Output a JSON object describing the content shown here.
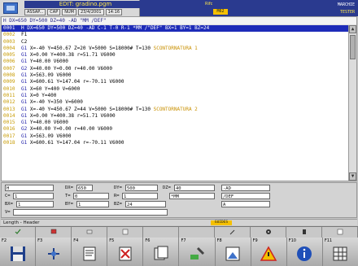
{
  "titlebar": {
    "title": "EDIT: gradino.pgm",
    "fields": [
      "ASSAP...",
      "CAP",
      "NUM",
      "23/4/2001",
      "14:16"
    ],
    "mid_label": "Rifc",
    "mid_badge": "M62",
    "right_label": "MARCHIE",
    "right_sub": "TESTER"
  },
  "program": {
    "header": "H DX=650 DY=500 DZ=40 -AD \"MM /DEF\"",
    "lines": [
      {
        "n": "0001",
        "kw": "",
        "code": "H DX=650 DY=500 DZ=40 -AD C-1 T-0 R-1 *MM /\"DEF\" BX=1 BY=1 BZ=24",
        "cmt": "",
        "selected": true
      },
      {
        "n": "0002",
        "kw": "",
        "code": "F1",
        "cmt": "",
        "selected": false
      },
      {
        "n": "0003",
        "kw": "",
        "code": "C2",
        "cmt": "",
        "selected": false
      },
      {
        "n": "0004",
        "kw": "G1",
        "code": "X=-40 Y=450.67 Z=20 V=5000 S=18000# T=130",
        "cmt": "SCONTORNATURA 1",
        "selected": false
      },
      {
        "n": "0005",
        "kw": "G1",
        "code": "X=0.00 Y=400.38 r=51.71 V6000",
        "cmt": "",
        "selected": false
      },
      {
        "n": "0006",
        "kw": "G1",
        "code": "Y=40.00 V6000",
        "cmt": "",
        "selected": false
      },
      {
        "n": "0007",
        "kw": "G2",
        "code": "X=40.00 Y=0.00 r=40.00 V6000",
        "cmt": "",
        "selected": false
      },
      {
        "n": "0008",
        "kw": "G1",
        "code": "X=563.09 V6000",
        "cmt": "",
        "selected": false
      },
      {
        "n": "0009",
        "kw": "G1",
        "code": "X=600.61 Y=147.04 r=-70.11 V6000",
        "cmt": "",
        "selected": false
      },
      {
        "n": "0010",
        "kw": "G1",
        "code": "X=60 Y=400 V=6000",
        "cmt": "",
        "selected": false
      },
      {
        "n": "0011",
        "kw": "G1",
        "code": "X=0 Y=400",
        "cmt": "",
        "selected": false
      },
      {
        "n": "0012",
        "kw": "G1",
        "code": "X=-40 Y=350 V=6000",
        "cmt": "",
        "selected": false
      },
      {
        "n": "0013",
        "kw": "G1",
        "code": "X=-40 Y=450.67 Z=44 V=5000 S=18000# T=130",
        "cmt": "SCONTORNATURA 2",
        "selected": false
      },
      {
        "n": "0014",
        "kw": "G1",
        "code": "X=0.00 Y=400.38 r=51.71 V6000",
        "cmt": "",
        "selected": false
      },
      {
        "n": "0015",
        "kw": "G1",
        "code": "Y=40.00 V6000",
        "cmt": "",
        "selected": false
      },
      {
        "n": "0016",
        "kw": "G2",
        "code": "X=40.00 Y=0.00 r=40.00 V6000",
        "cmt": "",
        "selected": false
      },
      {
        "n": "0017",
        "kw": "G1",
        "code": "X=563.09 V6000",
        "cmt": "",
        "selected": false
      },
      {
        "n": "0018",
        "kw": "G1",
        "code": "X=600.61 Y=147.04 r=-70.11 V6000",
        "cmt": "",
        "selected": false
      }
    ]
  },
  "params": {
    "row1": [
      {
        "label": "",
        "value": "H"
      },
      {
        "label": "DX=",
        "value": "650"
      },
      {
        "label": "DY=",
        "value": "500"
      },
      {
        "label": "DZ=",
        "value": "40"
      },
      {
        "label": "",
        "value": "-AD"
      }
    ],
    "row2": [
      {
        "label": "C=",
        "value": "1"
      },
      {
        "label": "T=",
        "value": "0"
      },
      {
        "label": "R=",
        "value": "1"
      },
      {
        "label": "",
        "value": "*MM"
      },
      {
        "label": "",
        "value": "/DEF"
      }
    ],
    "row3": [
      {
        "label": "BX=",
        "value": "1"
      },
      {
        "label": "BY=",
        "value": "1"
      },
      {
        "label": "BZ=",
        "value": "24"
      },
      {
        "label": "",
        "value": ""
      },
      {
        "label": "",
        "value": "A"
      }
    ],
    "row4": [
      {
        "label": "V=",
        "value": ""
      }
    ]
  },
  "status": {
    "text": "Length - Header",
    "badge": "GUIDES"
  },
  "softkeys": {
    "labels": [
      "F2",
      "F3",
      "F4",
      "F5",
      "F6",
      "F7",
      "F8",
      "F9",
      "F10",
      "F11"
    ]
  }
}
